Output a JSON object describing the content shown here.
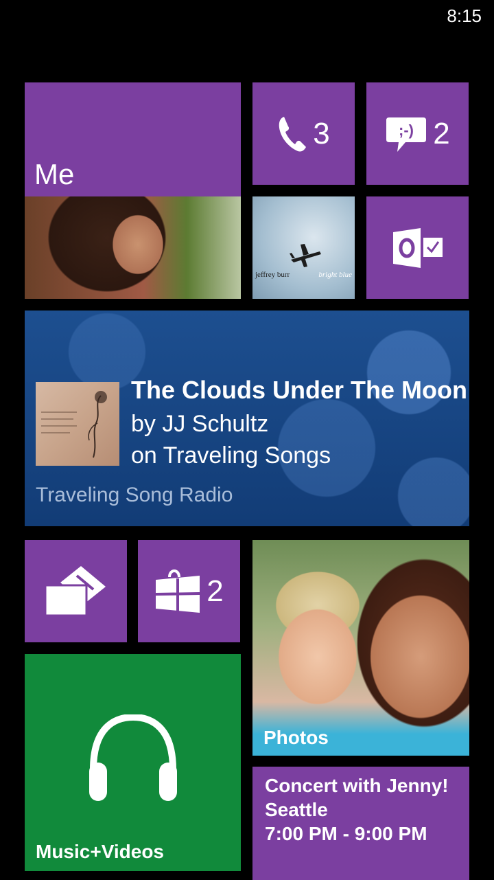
{
  "status_bar": {
    "time": "8:15"
  },
  "tiles": {
    "me": {
      "label": "Me"
    },
    "phone": {
      "count": "3",
      "icon": "phone-icon"
    },
    "messaging": {
      "count": "2",
      "icon": "messaging-icon"
    },
    "album": {
      "artist": "jeffrey burr",
      "album": "bright blue"
    },
    "outlook": {
      "icon": "outlook-icon"
    },
    "wallet": {
      "icon": "wallet-icon"
    },
    "store": {
      "count": "2",
      "icon": "store-icon"
    },
    "photos": {
      "label": "Photos"
    },
    "music": {
      "label": "Music+Videos",
      "icon": "headphones-icon"
    },
    "calendar": {
      "line1": "Concert with Jenny!",
      "line2": "Seattle",
      "line3": "7:00 PM - 9:00 PM"
    }
  },
  "now_playing": {
    "title": "The Clouds Under The Moon",
    "artist": "by JJ Schultz",
    "album": "on Traveling Songs",
    "station": "Traveling Song Radio"
  },
  "colors": {
    "tile_purple": "#7b3fa0",
    "tile_green": "#118a3b",
    "banner_blue": "#1d4f90",
    "background": "#000000"
  }
}
